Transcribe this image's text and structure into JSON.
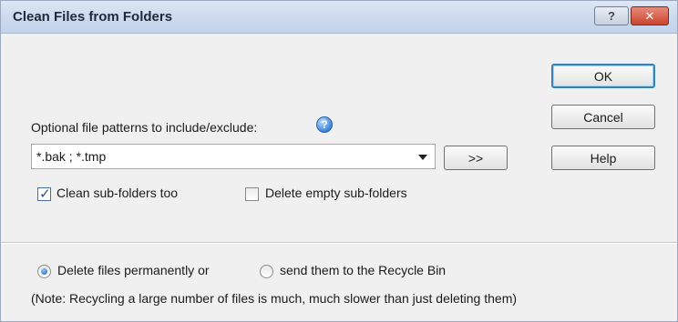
{
  "window": {
    "title": "Clean Files from Folders",
    "help_glyph": "?",
    "close_glyph": "✕"
  },
  "buttons": {
    "ok": "OK",
    "cancel": "Cancel",
    "help": "Help",
    "more": ">>"
  },
  "patterns": {
    "label": "Optional file patterns to include/exclude:",
    "info_glyph": "?",
    "value": "*.bak ; *.tmp"
  },
  "options": {
    "clean_subfolders": {
      "label": "Clean sub-folders too",
      "checked": true
    },
    "delete_empty": {
      "label": "Delete empty sub-folders",
      "checked": false
    }
  },
  "delete_mode": {
    "permanent_label": "Delete files permanently or",
    "recycle_label": "send them to the Recycle Bin",
    "selected": "permanent",
    "note": "(Note: Recycling a large number of files is much, much slower than just deleting them)"
  },
  "icons": {
    "info": "info-icon",
    "dropdown": "chevron-down-icon"
  }
}
